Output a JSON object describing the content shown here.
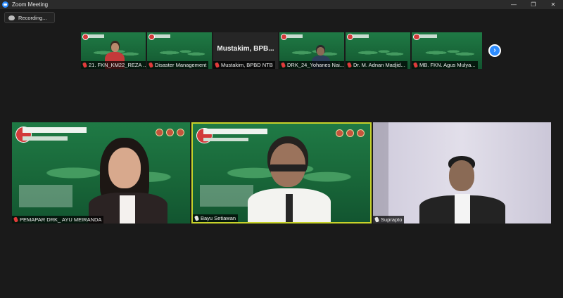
{
  "window": {
    "title": "Zoom Meeting",
    "controls": {
      "minimize": "—",
      "maximize": "❐",
      "close": "✕"
    }
  },
  "recording": {
    "label": "Recording..."
  },
  "thumbnails": [
    {
      "name": "21. FKN_KM22_REZA ...",
      "type": "video"
    },
    {
      "name": "Disaster Management",
      "type": "video"
    },
    {
      "name": "Mustakim, BPBD NTB",
      "type": "avatar",
      "display": "Mustakim,  BPB..."
    },
    {
      "name": "DRK_24_Yohanes Nai...",
      "type": "video"
    },
    {
      "name": "Dr. M. Adnan Madjid...",
      "type": "video"
    },
    {
      "name": "MB. FKN. Agus Mulya...",
      "type": "video"
    }
  ],
  "gallery_next": "›",
  "tiles": [
    {
      "name": "PEMAPAR DRK_ AYU MEIRANDA"
    },
    {
      "name": "Bayu Setiawan"
    },
    {
      "name": "Suprapto"
    }
  ]
}
